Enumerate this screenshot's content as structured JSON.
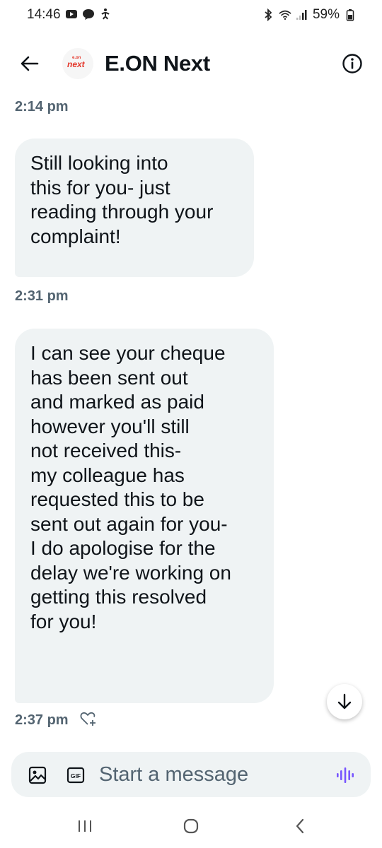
{
  "status_bar": {
    "time": "14:46",
    "battery": "59%"
  },
  "header": {
    "avatar_line1": "e.on",
    "avatar_line2": "next",
    "title": "E.ON Next"
  },
  "messages": [
    {
      "timestamp": "2:14 pm",
      "lines": []
    },
    {
      "timestamp": "2:31 pm",
      "lines": [
        "Still looking into",
        "this for you- just",
        "reading through your",
        "complaint!"
      ]
    },
    {
      "timestamp": "2:37 pm",
      "lines": [
        "I can see your cheque",
        "has been sent out",
        "and marked as paid",
        "however you'll still",
        "not received this-",
        "my colleague has",
        "requested this to be",
        "sent out again for you-",
        "I do apologise for the",
        "delay we're working on",
        "getting this resolved",
        "for you!"
      ]
    }
  ],
  "composer": {
    "gif_label": "GIF",
    "placeholder": "Start a message"
  },
  "colors": {
    "bubble_bg": "#eff3f4",
    "timestamp": "#536471",
    "brand_red": "#e4372b",
    "voice_accent": "#7856ff"
  },
  "icons": [
    "camera-status-icon",
    "message-status-icon",
    "accessibility-status-icon",
    "bluetooth-icon",
    "wifi-icon",
    "signal-icon",
    "battery-icon",
    "back-arrow-icon",
    "info-icon",
    "react-heart-icon",
    "arrow-down-icon",
    "image-icon",
    "gif-icon",
    "voice-icon",
    "recents-icon",
    "home-icon",
    "back-icon"
  ]
}
